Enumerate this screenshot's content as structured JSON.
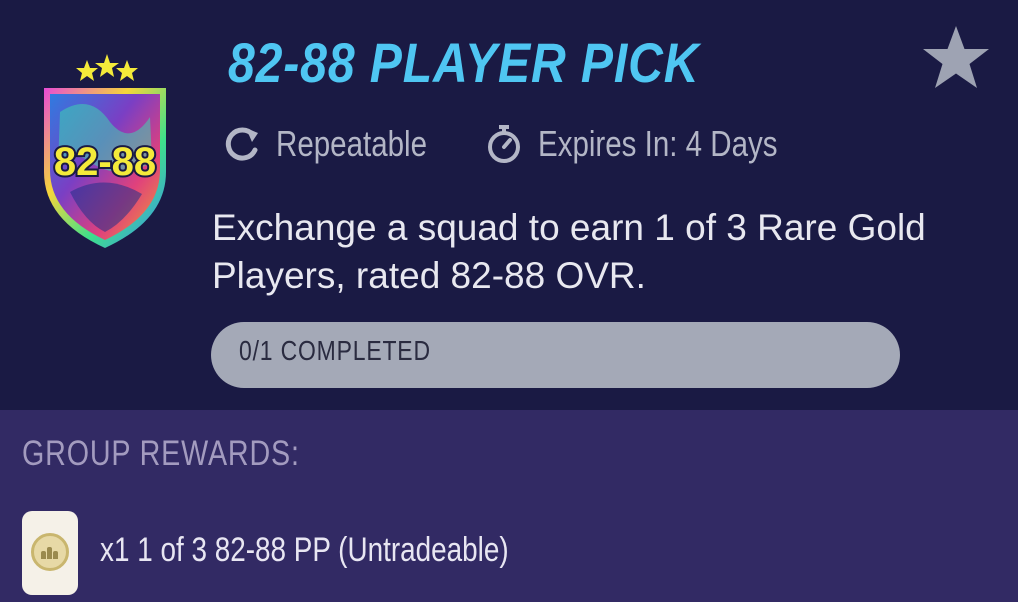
{
  "challenge": {
    "badge_label": "82-88",
    "title": "82-88 PLAYER PICK",
    "repeat_label": "Repeatable",
    "expires_label": "Expires In: 4 Days",
    "description": "Exchange a squad to earn 1 of 3 Rare Gold Players, rated 82-88 OVR.",
    "progress_label": "0/1 COMPLETED",
    "progress_fraction": 0,
    "favorite_icon": "star-icon"
  },
  "rewards": {
    "heading": "GROUP REWARDS:",
    "items": [
      {
        "label": "x1 1 of 3 82-88 PP (Untradeable)",
        "icon": "player-pick-card-icon"
      }
    ]
  },
  "colors": {
    "title": "#4fc6f2",
    "top_background": "#1a1a44",
    "rewards_background": "#322a64",
    "progress_track": "#a4a9b7",
    "badge_text": "#f4ea3a",
    "star": "#9ea3b3"
  }
}
